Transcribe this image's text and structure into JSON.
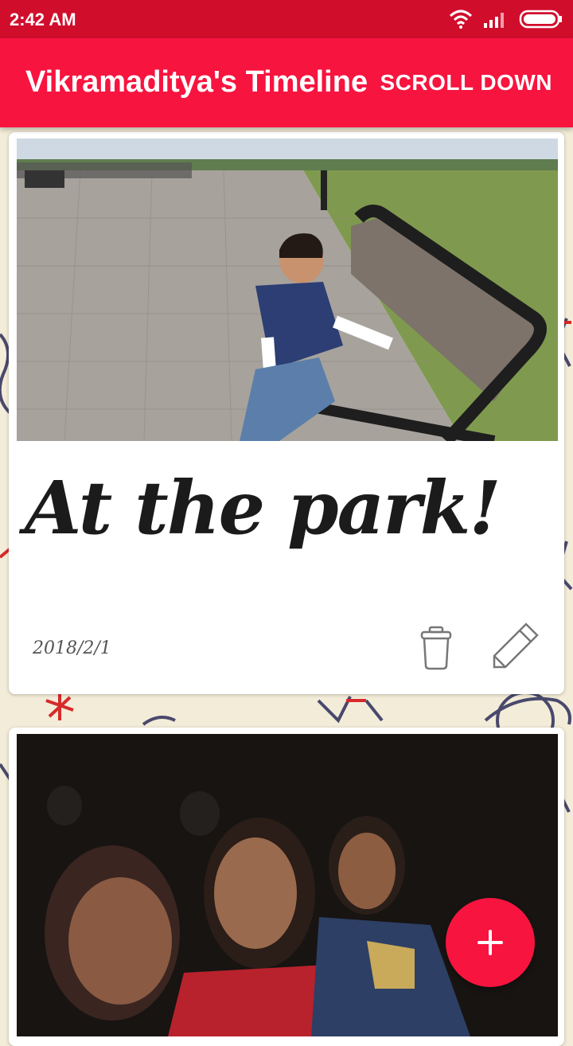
{
  "status_bar": {
    "time": "2:42 AM",
    "icons": [
      "wifi-icon",
      "signal-icon",
      "battery-icon"
    ]
  },
  "app_bar": {
    "title": "Vikramaditya's Timeline",
    "action_label": "SCROLL DOWN"
  },
  "colors": {
    "status_bar": "#d10d2c",
    "app_bar": "#f7143f",
    "fab": "#f7143f",
    "background": "#f3ecd8"
  },
  "timeline": [
    {
      "caption": "At the park!",
      "date": "2018/2/1",
      "actions": [
        "trash-icon",
        "pencil-icon"
      ]
    },
    {}
  ],
  "fab": {
    "icon": "plus-icon"
  }
}
